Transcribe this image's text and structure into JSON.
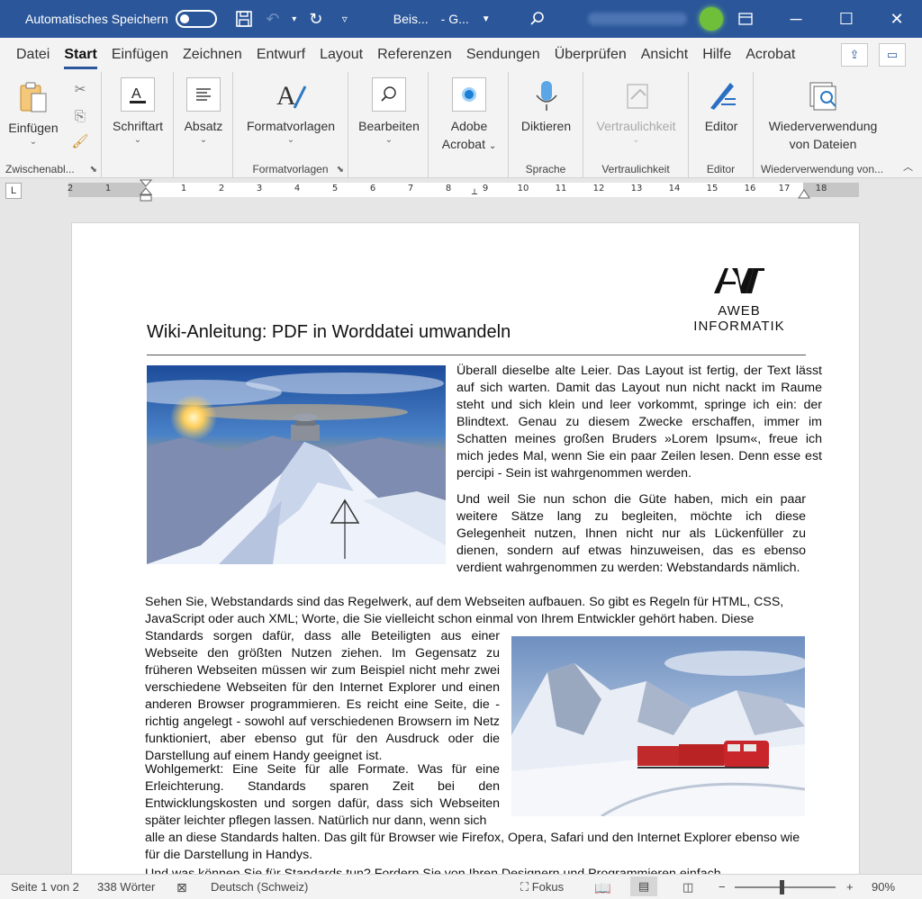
{
  "titlebar": {
    "autosave_label": "Automatisches Speichern",
    "autosave_state": "off",
    "doc_name": "Beis...",
    "doc_suffix": "- G...",
    "colors": {
      "bar": "#2b579a"
    }
  },
  "tabs": [
    "Datei",
    "Start",
    "Einfügen",
    "Zeichnen",
    "Entwurf",
    "Layout",
    "Referenzen",
    "Sendungen",
    "Überprüfen",
    "Ansicht",
    "Hilfe",
    "Acrobat"
  ],
  "active_tab": "Start",
  "ribbon": {
    "paste": "Einfügen",
    "clipboard_group": "Zwischenabl...",
    "font": "Schriftart",
    "paragraph": "Absatz",
    "styles": "Formatvorlagen",
    "styles_group": "Formatvorlagen",
    "editing": "Bearbeiten",
    "adobe_line1": "Adobe",
    "adobe_line2": "Acrobat",
    "dictate": "Diktieren",
    "speech_group": "Sprache",
    "sensitivity": "Vertraulichkeit",
    "sensitivity_group": "Vertraulichkeit",
    "editor": "Editor",
    "editor_group": "Editor",
    "reuse_line1": "Wiederverwendung",
    "reuse_line2": "von Dateien",
    "reuse_group": "Wiederverwendung von..."
  },
  "ruler": {
    "tab_selector": "L",
    "labels": [
      "2",
      "1",
      "1",
      "2",
      "3",
      "4",
      "5",
      "6",
      "7",
      "8",
      "9",
      "10",
      "11",
      "12",
      "13",
      "14",
      "15",
      "16",
      "17",
      "18"
    ]
  },
  "document": {
    "title": "Wiki-Anleitung: PDF in Worddatei umwandeln",
    "logo_text": "AWEB INFORMATIK",
    "para1": "Überall dieselbe alte Leier. Das Layout ist fertig, der Text lässt auf sich warten. Damit das Layout nun nicht nackt im Raume steht und sich klein und leer vorkommt, springe ich ein: der Blindtext. Genau zu diesem Zwecke erschaffen, immer im Schatten meines großen Bruders »Lorem Ipsum«, freue ich mich jedes Mal, wenn Sie ein paar Zeilen lesen. Denn esse est percipi - Sein ist wahrgenommen werden.",
    "para2": "Und weil Sie nun schon die Güte haben, mich ein paar weitere Sätze lang zu begleiten, möchte ich diese Gelegenheit nutzen, Ihnen nicht nur als Lückenfüller zu dienen, sondern auf etwas hinzuweisen, das es ebenso verdient wahrgenommen zu werden: Webstandards nämlich.",
    "para3a": "Sehen Sie, Webstandards sind das Regelwerk, auf dem Webseiten aufbauen. So gibt es Regeln für HTML, CSS, JavaScript oder auch XML; Worte, die Sie vielleicht schon einmal von Ihrem Entwickler gehört haben. Diese",
    "para3b": "Standards sorgen dafür, dass alle Beteiligten aus einer Webseite den größten Nutzen ziehen. Im Gegensatz zu früheren Webseiten müssen wir zum Beispiel nicht mehr zwei verschiedene Webseiten für den Internet Explorer und einen anderen Browser programmieren. Es reicht eine Seite, die - richtig angelegt - sowohl auf verschiedenen Browsern im Netz funktioniert, aber ebenso gut für den Ausdruck oder die Darstellung auf einem Handy geeignet ist.",
    "para4a": "Wohlgemerkt: Eine Seite für alle Formate. Was für eine Erleichterung. Standards sparen Zeit bei den Entwicklungskosten und sorgen dafür, dass sich Webseiten später leichter pflegen lassen. Natürlich nur dann, wenn sich",
    "para4b": "alle an diese Standards halten. Das gilt für Browser wie Firefox, Opera, Safari und den Internet Explorer ebenso wie für die Darstellung in Handys.",
    "para5": "Und was können Sie für Standards tun? Fordern Sie von Ihren Designern und Programmieren einfach"
  },
  "statusbar": {
    "page": "Seite 1 von 2",
    "words": "338 Wörter",
    "language": "Deutsch (Schweiz)",
    "focus": "Fokus",
    "zoom_minus": "−",
    "zoom_plus": "+",
    "zoom": "90%",
    "zoom_level_percent": 90
  }
}
